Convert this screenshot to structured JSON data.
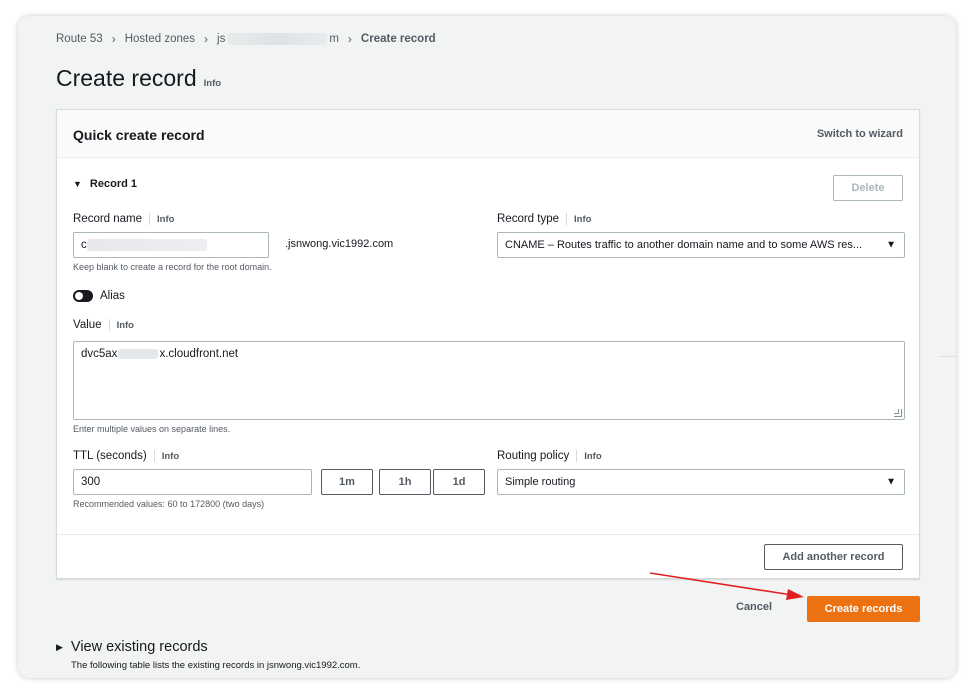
{
  "breadcrumb": {
    "items": [
      "Route 53",
      "Hosted zones",
      "js",
      "m"
    ],
    "current": "Create record"
  },
  "page": {
    "title": "Create record",
    "info": "Info"
  },
  "quick_create": {
    "header": "Quick create record",
    "switch_wizard": "Switch to wizard",
    "record_label": "Record 1",
    "delete_label": "Delete"
  },
  "record_name": {
    "label": "Record name",
    "info": "Info",
    "value_prefix": "c",
    "domain_suffix": ".jsnwong.vic1992.com",
    "hint": "Keep blank to create a record for the root domain."
  },
  "record_type": {
    "label": "Record type",
    "info": "Info",
    "value": "CNAME – Routes traffic to another domain name and to some AWS res..."
  },
  "alias": {
    "label": "Alias",
    "enabled": false
  },
  "value_field": {
    "label": "Value",
    "info": "Info",
    "prefix": "dvc5ax",
    "suffix": "x.cloudfront.net",
    "hint": "Enter multiple values on separate lines."
  },
  "ttl": {
    "label": "TTL (seconds)",
    "info": "Info",
    "value": "300",
    "presets": [
      "1m",
      "1h",
      "1d"
    ],
    "hint": "Recommended values: 60 to 172800 (two days)"
  },
  "routing_policy": {
    "label": "Routing policy",
    "info": "Info",
    "value": "Simple routing"
  },
  "actions": {
    "add_another": "Add another record",
    "cancel": "Cancel",
    "create": "Create records"
  },
  "existing": {
    "title": "View existing records",
    "description": "The following table lists the existing records in jsnwong.vic1992.com."
  },
  "colors": {
    "primary_button": "#ec7211",
    "annotation_arrow": "#e02020"
  }
}
